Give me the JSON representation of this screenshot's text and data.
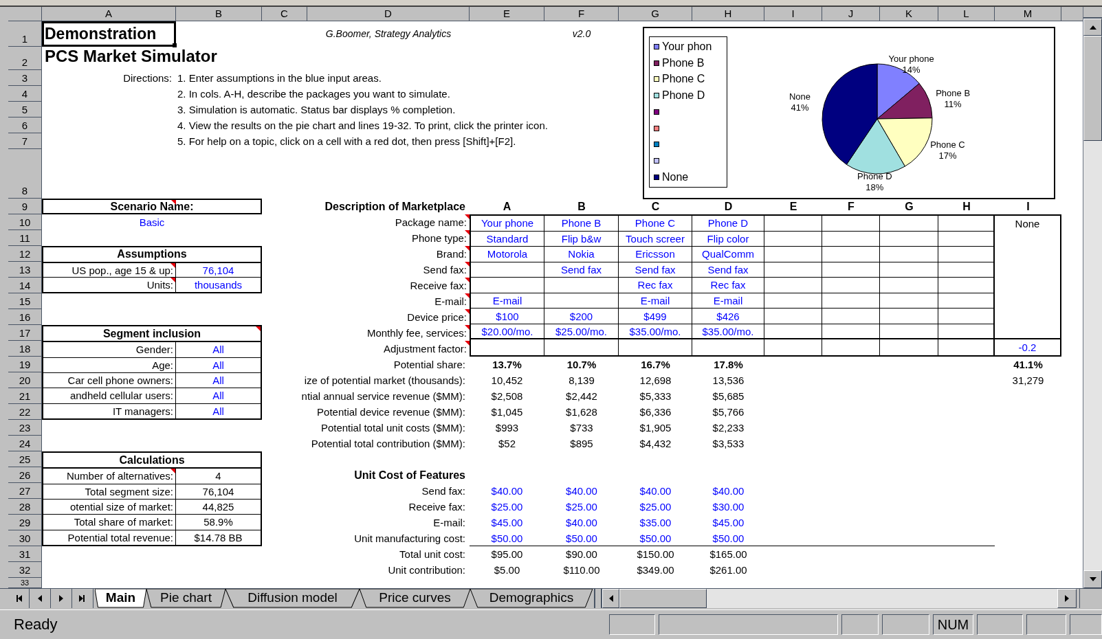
{
  "column_headers": [
    "A",
    "B",
    "C",
    "D",
    "E",
    "F",
    "G",
    "H",
    "I",
    "J",
    "K",
    "L",
    "M"
  ],
  "row_headers": [
    "1",
    "2",
    "3",
    "4",
    "5",
    "6",
    "7",
    "8",
    "9",
    "10",
    "11",
    "12",
    "13",
    "14",
    "15",
    "16",
    "17",
    "18",
    "19",
    "20",
    "21",
    "22",
    "23",
    "24",
    "25",
    "26",
    "27",
    "28",
    "29",
    "30",
    "31",
    "32",
    "33"
  ],
  "title": {
    "text": "Demonstration",
    "selected": true
  },
  "subtitle": "PCS Market Simulator",
  "author": "G.Boomer, Strategy Analytics",
  "version": "v2.0",
  "directions": {
    "label": "Directions:",
    "steps": [
      "1. Enter assumptions in the blue input areas.",
      "2. In cols. A-H, describe the packages you want to simulate.",
      "3. Simulation is automatic.  Status bar displays % completion.",
      "4. View the results on the pie chart and lines 19-32.  To print, click the printer icon.",
      "5. For help on a topic, click on a cell with a red dot, then press [Shift]+[F2]."
    ]
  },
  "chart": {
    "legend": [
      {
        "label": "Your phon",
        "color": "#8080ff"
      },
      {
        "label": "Phone B",
        "color": "#802060"
      },
      {
        "label": "Phone C",
        "color": "#ffffc0"
      },
      {
        "label": "Phone D",
        "color": "#a0e0e0"
      },
      {
        "color": "#800080"
      },
      {
        "color": "#ff8080"
      },
      {
        "color": "#0080c0"
      },
      {
        "color": "#c0c0ff"
      },
      {
        "label": "None",
        "color": "#000080"
      }
    ],
    "chart_data": {
      "type": "pie",
      "categories": [
        "Your phone",
        "Phone B",
        "Phone C",
        "Phone D",
        "None"
      ],
      "values": [
        14,
        11,
        17,
        18,
        41
      ],
      "value_labels": [
        "14%",
        "11%",
        "17%",
        "18%",
        "41%"
      ]
    }
  },
  "scenario": {
    "heading": "Scenario Name:",
    "note": true,
    "input": true,
    "value": "Basic"
  },
  "assumptions": {
    "heading": "Assumptions",
    "input": true,
    "rows": [
      {
        "label": "US pop., age 15 & up:",
        "note": true,
        "value": "76,104"
      },
      {
        "label": "Units:",
        "note": true,
        "value": "thousands"
      }
    ]
  },
  "segment_inclusion": {
    "heading": "Segment inclusion",
    "note": true,
    "input": true,
    "rows": [
      {
        "label": "Gender:",
        "note": false,
        "value": "All"
      },
      {
        "label": "Age:",
        "note": false,
        "value": "All"
      },
      {
        "label": "Car cell phone owners:",
        "note": false,
        "value": "All"
      },
      {
        "label": "andheld cellular users:",
        "note": false,
        "value": "All"
      },
      {
        "label": "IT managers:",
        "note": false,
        "value": "All"
      }
    ]
  },
  "calculations": {
    "heading": "Calculations",
    "input": false,
    "rows": [
      {
        "label": "Number of alternatives:",
        "note": true,
        "value": "4"
      },
      {
        "label": "Total segment size:",
        "note": false,
        "value": "76,104"
      },
      {
        "label": "otential size of market:",
        "note": false,
        "value": "44,825"
      },
      {
        "label": "Total share of market:",
        "note": false,
        "value": "58.9%"
      },
      {
        "label": "Potential total revenue:",
        "note": false,
        "value": "$14.78 BB"
      }
    ]
  },
  "marketplace": {
    "heading": "Description of Marketplace",
    "columns": [
      "A",
      "B",
      "C",
      "D",
      "E",
      "F",
      "G",
      "H",
      "I"
    ],
    "rows": [
      {
        "label": "Package name:",
        "note": true,
        "cells": [
          "Your phone",
          "Phone B",
          "Phone C",
          "Phone D",
          null,
          null,
          null,
          null
        ],
        "column_I": {
          "text": "None",
          "input": false
        }
      },
      {
        "label": "Phone type:",
        "note": true,
        "cells": [
          "Standard",
          "Flip b&w",
          "Touch screer",
          "Flip color",
          null,
          null,
          null,
          null
        ]
      },
      {
        "label": "Brand:",
        "note": true,
        "cells": [
          "Motorola",
          "Nokia",
          "Ericsson",
          "QualComm",
          null,
          null,
          null,
          null
        ]
      },
      {
        "label": "Send fax:",
        "note": true,
        "cells": [
          null,
          "Send fax",
          "Send fax",
          "Send fax",
          null,
          null,
          null,
          null
        ]
      },
      {
        "label": "Receive fax:",
        "note": true,
        "cells": [
          null,
          null,
          "Rec fax",
          "Rec fax",
          null,
          null,
          null,
          null
        ]
      },
      {
        "label": "E-mail:",
        "note": true,
        "cells": [
          "E-mail",
          null,
          "E-mail",
          "E-mail",
          null,
          null,
          null,
          null
        ]
      },
      {
        "label": "Device price:",
        "note": true,
        "cells": [
          "$100",
          "$200",
          "$499",
          "$426",
          null,
          null,
          null,
          null
        ]
      },
      {
        "label": "Monthly fee, services:",
        "note": true,
        "cells": [
          "$20.00/mo.",
          "$25.00/mo.",
          "$35.00/mo.",
          "$35.00/mo.",
          null,
          null,
          null,
          null
        ]
      },
      {
        "label": "Adjustment factor:",
        "note": true,
        "cells": [
          null,
          null,
          null,
          null,
          null,
          null,
          null,
          null
        ],
        "column_I": {
          "text": "-0.2",
          "input": true
        }
      }
    ]
  },
  "results": [
    {
      "label": "Potential share:",
      "bold": true,
      "values": [
        "13.7%",
        "10.7%",
        "16.7%",
        "17.8%"
      ],
      "column_I": "41.1%"
    },
    {
      "label": "ize of potential market (thousands):",
      "bold": false,
      "values": [
        "10,452",
        "8,139",
        "12,698",
        "13,536"
      ],
      "column_I": "31,279"
    },
    {
      "label": "ntial annual service revenue ($MM):",
      "bold": false,
      "values": [
        "$2,508",
        "$2,442",
        "$5,333",
        "$5,685"
      ]
    },
    {
      "label": "Potential device revenue ($MM):",
      "bold": false,
      "values": [
        "$1,045",
        "$1,628",
        "$6,336",
        "$5,766"
      ]
    },
    {
      "label": "Potential total unit costs ($MM):",
      "bold": false,
      "values": [
        "$993",
        "$733",
        "$1,905",
        "$2,233"
      ]
    },
    {
      "label": "Potential total contribution ($MM):",
      "bold": false,
      "values": [
        "$52",
        "$895",
        "$4,432",
        "$3,533"
      ]
    }
  ],
  "unit_costs": {
    "heading": "Unit Cost of Features",
    "rows": [
      {
        "label": "Send fax:",
        "kind": "input",
        "values": [
          "$40.00",
          "$40.00",
          "$40.00",
          "$40.00"
        ]
      },
      {
        "label": "Receive fax:",
        "kind": "input",
        "values": [
          "$25.00",
          "$25.00",
          "$25.00",
          "$30.00"
        ]
      },
      {
        "label": "E-mail:",
        "kind": "input",
        "values": [
          "$45.00",
          "$40.00",
          "$35.00",
          "$45.00"
        ]
      },
      {
        "label": "Unit manufacturing cost:",
        "kind": "input",
        "values": [
          "$50.00",
          "$50.00",
          "$50.00",
          "$50.00"
        ]
      },
      {
        "label": "Total unit cost:",
        "kind": "total",
        "values": [
          "$95.00",
          "$90.00",
          "$150.00",
          "$165.00"
        ]
      },
      {
        "label": "Unit contribution:",
        "kind": "total",
        "values": [
          "$5.00",
          "$110.00",
          "$349.00",
          "$261.00"
        ]
      }
    ]
  },
  "sheet_tabs": [
    {
      "label": "Main",
      "selected": true
    },
    {
      "label": "Pie chart",
      "selected": false
    },
    {
      "label": "Diffusion model",
      "selected": false
    },
    {
      "label": "Price curves",
      "selected": false
    },
    {
      "label": "Demographics",
      "selected": false
    }
  ],
  "status_bar": {
    "message": "Ready",
    "indicators": [
      "NUM"
    ]
  }
}
